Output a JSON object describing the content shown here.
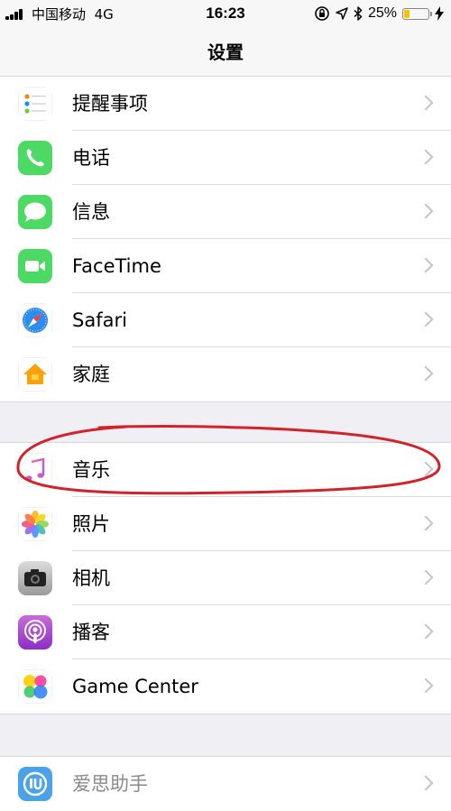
{
  "status_bar": {
    "carrier": "中国移动",
    "network": "4G",
    "time": "16:23",
    "battery": "25%",
    "battery_level": 0.25,
    "icons": [
      "signal-icon",
      "orientation-lock-icon",
      "location-icon",
      "bluetooth-icon",
      "battery-icon",
      "charging-icon"
    ]
  },
  "nav": {
    "title": "设置"
  },
  "groups": [
    {
      "items": [
        {
          "label": "提醒事项",
          "icon": "reminders-icon"
        },
        {
          "label": "电话",
          "icon": "phone-icon"
        },
        {
          "label": "信息",
          "icon": "messages-icon"
        },
        {
          "label": "FaceTime",
          "icon": "facetime-icon"
        },
        {
          "label": "Safari",
          "icon": "safari-icon"
        },
        {
          "label": "家庭",
          "icon": "home-icon"
        }
      ]
    },
    {
      "items": [
        {
          "label": "音乐",
          "icon": "music-icon"
        },
        {
          "label": "照片",
          "icon": "photos-icon"
        },
        {
          "label": "相机",
          "icon": "camera-icon"
        },
        {
          "label": "播客",
          "icon": "podcasts-icon"
        },
        {
          "label": "Game Center",
          "icon": "game-center-icon"
        }
      ]
    },
    {
      "items": [
        {
          "label": "爱思助手",
          "icon": "aisi-icon"
        }
      ]
    }
  ],
  "colors": {
    "annotation": "#d2232a",
    "battery_fill": "#f5c400",
    "chevron": "#c4c4c8",
    "background": "#efeff4"
  }
}
